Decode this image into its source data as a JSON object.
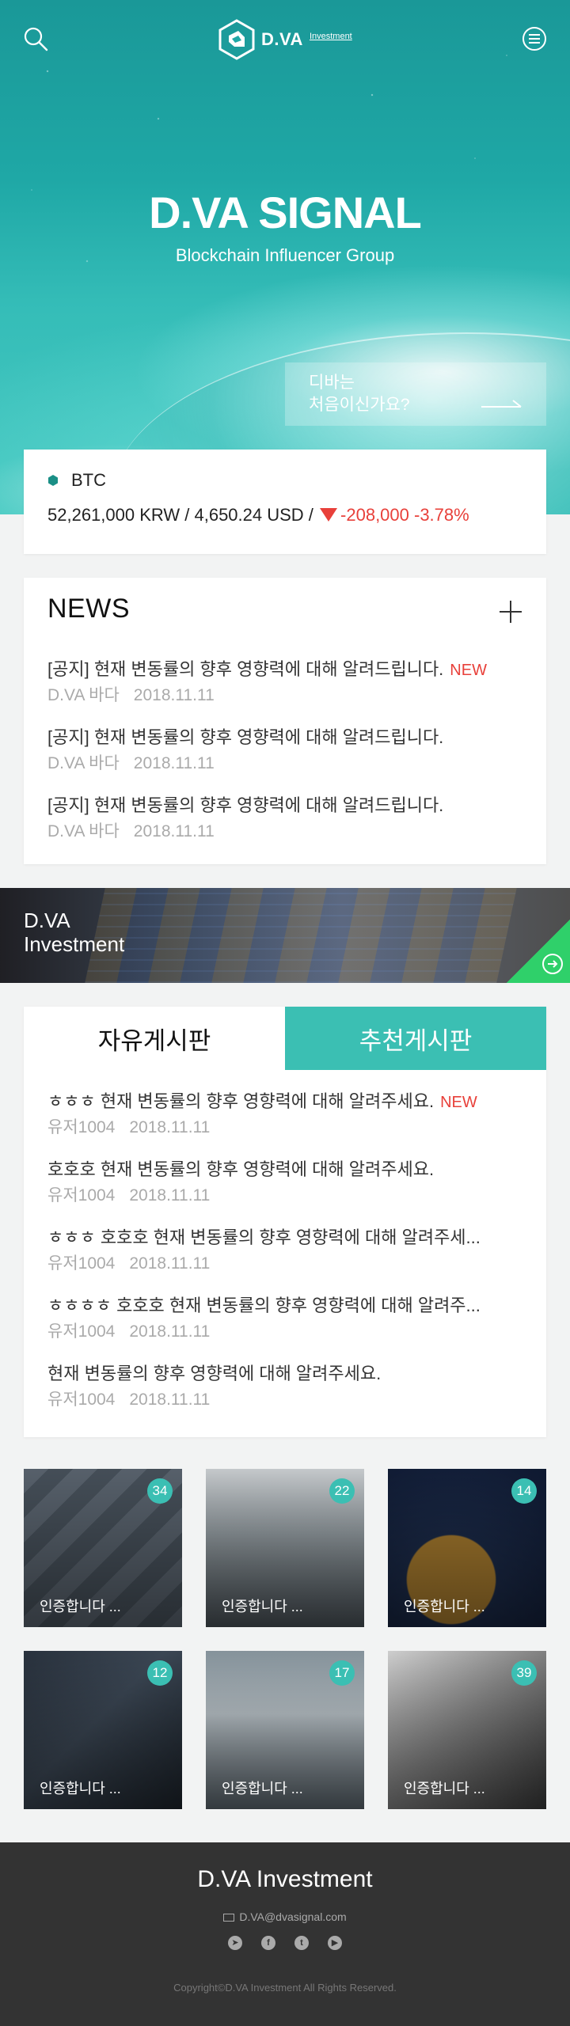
{
  "header": {
    "logo_main": "D.VA",
    "logo_sub": "Investment"
  },
  "hero": {
    "title": "D.VA SIGNAL",
    "subtitle": "Blockchain Influencer Group",
    "first_time_line1": "디바는",
    "first_time_line2": "처음이신가요?"
  },
  "ticker": {
    "symbol": "BTC",
    "price_text": "52,261,000 KRW / 4,650.24 USD / ",
    "change_text": "-208,000 -3.78%",
    "direction": "down",
    "accent_color": "#1a8f86",
    "negative_color": "#e8403a"
  },
  "news": {
    "title": "NEWS",
    "new_label": "NEW",
    "items": [
      {
        "title": "[공지] 현재 변동률의 향후 영향력에 대해 알려드립니다.",
        "author": "D.VA 바다",
        "date": "2018.11.11",
        "is_new": "NEW"
      },
      {
        "title": "[공지] 현재 변동률의 향후 영향력에 대해 알려드립니다.",
        "author": "D.VA 바다",
        "date": "2018.11.11"
      },
      {
        "title": "[공지] 현재 변동률의 향후 영향력에 대해 알려드립니다.",
        "author": "D.VA 바다",
        "date": "2018.11.11"
      }
    ]
  },
  "banner": {
    "line1": "D.VA",
    "line2": "Investment"
  },
  "board": {
    "tabs": [
      {
        "label": "자유게시판",
        "active": true
      },
      {
        "label": "추천게시판",
        "active": false
      }
    ],
    "items": [
      {
        "title": "ㅎㅎㅎ 현재 변동률의 향후 영향력에 대해 알려주세요.",
        "author": "유저1004",
        "date": "2018.11.11",
        "is_new": "NEW"
      },
      {
        "title": "호호호 현재 변동률의 향후 영향력에 대해 알려주세요.",
        "author": "유저1004",
        "date": "2018.11.11"
      },
      {
        "title": "ㅎㅎㅎ 호호호 현재 변동률의 향후 영향력에 대해 알려주세...",
        "author": "유저1004",
        "date": "2018.11.11"
      },
      {
        "title": "ㅎㅎㅎㅎ 호호호 현재 변동률의 향후 영향력에 대해 알려주...",
        "author": "유저1004",
        "date": "2018.11.11"
      },
      {
        "title": "현재 변동률의 향후 영향력에 대해 알려주세요.",
        "author": "유저1004",
        "date": "2018.11.11"
      }
    ],
    "accent_color": "#3bbfb3"
  },
  "gallery": [
    {
      "caption": "인증합니다 ...",
      "count": "34"
    },
    {
      "caption": "인증합니다 ...",
      "count": "22"
    },
    {
      "caption": "인증합니다 ...",
      "count": "14"
    },
    {
      "caption": "인증합니다 ...",
      "count": "12"
    },
    {
      "caption": "인증합니다 ...",
      "count": "17"
    },
    {
      "caption": "인증합니다 ...",
      "count": "39"
    }
  ],
  "footer": {
    "title": "D.VA Investment",
    "email": "D.VA@dvasignal.com",
    "social_icons": [
      "telegram-icon",
      "facebook-icon",
      "twitter-icon",
      "youtube-icon"
    ],
    "copyright": "Copyright©D.VA Investment All Rights Reserved."
  }
}
